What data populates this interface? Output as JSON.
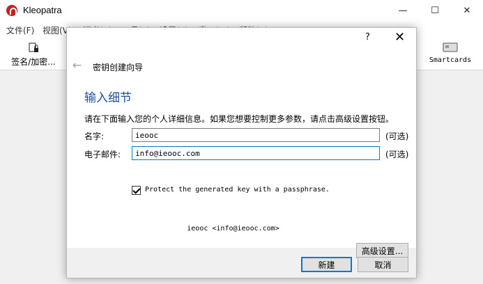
{
  "main_window": {
    "title": "Kleopatra",
    "controls": {
      "minimize": "—",
      "maximize": "☐",
      "close": "✕"
    },
    "menu": [
      "文件(F)",
      "视图(V)",
      "证书(C)",
      "工具(T)",
      "设置(S)",
      "窗口(W)",
      "帮助(H)"
    ],
    "toolbar": {
      "sign_encrypt_label": "签名/加密...",
      "smartcards_label": "Smartcards"
    }
  },
  "dialog": {
    "help": "?",
    "close": "✕",
    "wizard_title": "密钥创建向导",
    "page_heading": "输入细节",
    "instructions": "请在下面输入您的个人详细信息。如果您想要控制更多参数，请点击高级设置按钮。",
    "name": {
      "label": "名字:",
      "value": "ieooc",
      "optional": "(可选)"
    },
    "email": {
      "label": "电子邮件:",
      "value": "info@ieooc.com",
      "optional": "(可选)"
    },
    "passphrase_checkbox": {
      "label": "Protect the generated key with a passphrase.",
      "checked": true
    },
    "summary": "ieooc <info@ieooc.com>",
    "advanced_button": "高级设置...",
    "create_button": "新建",
    "cancel_button": "取消"
  },
  "colors": {
    "accent": "#0078d7",
    "heading": "#1f4e9c",
    "app_icon": "#c8201e"
  }
}
